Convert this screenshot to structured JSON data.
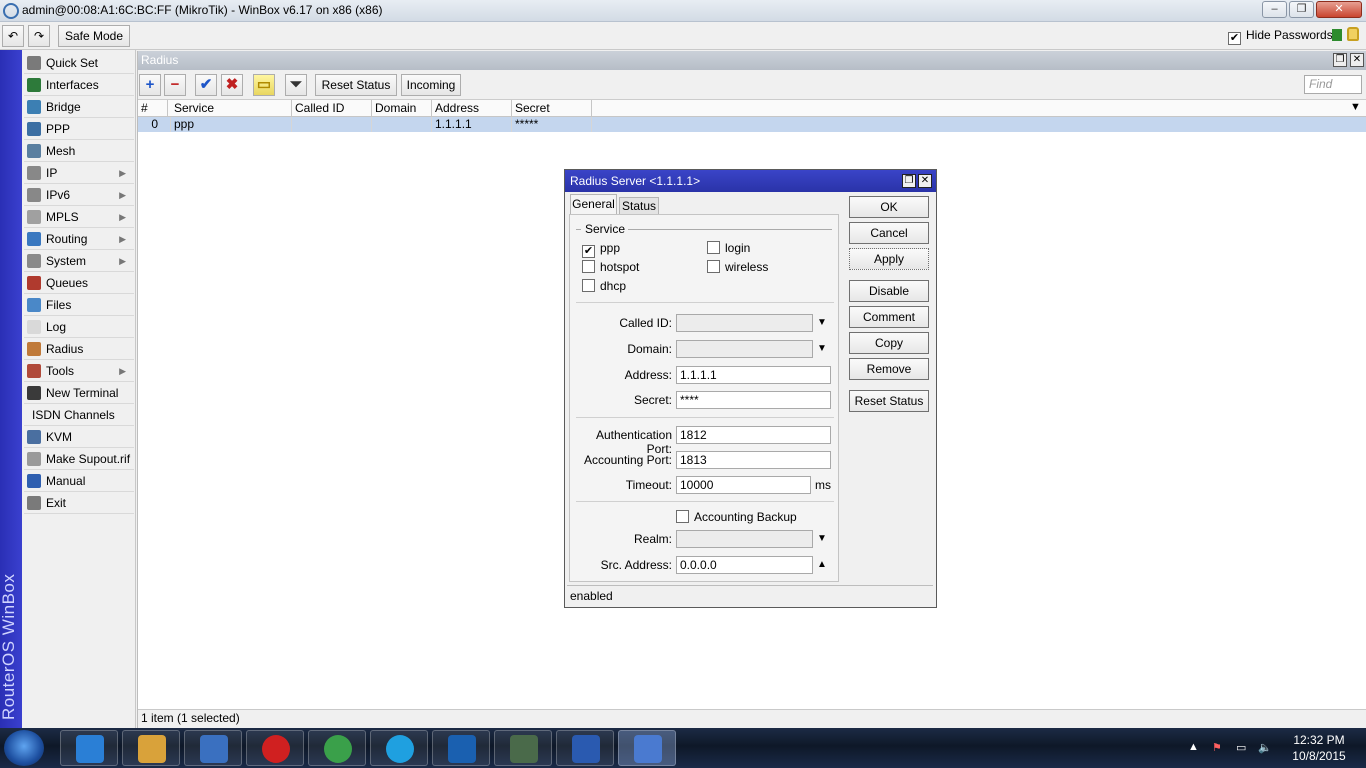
{
  "window": {
    "title": "admin@00:08:A1:6C:BC:FF (MikroTik) - WinBox v6.17 on x86 (x86)",
    "min": "–",
    "max": "❐",
    "close": "✕"
  },
  "toolbar": {
    "undo": "↶",
    "redo": "↷",
    "safe_mode": "Safe Mode",
    "hide_passwords_label": "Hide Passwords",
    "hide_passwords_checked": "✔"
  },
  "brand": {
    "text": "RouterOS WinBox"
  },
  "menu": [
    {
      "label": "Quick Set",
      "icon": "quickset-icon",
      "color": "#7a7a7a"
    },
    {
      "label": "Interfaces",
      "icon": "interfaces-icon",
      "color": "#2d7a3a"
    },
    {
      "label": "Bridge",
      "icon": "bridge-icon",
      "color": "#3c7fb3"
    },
    {
      "label": "PPP",
      "icon": "ppp-icon",
      "color": "#3c6fa3"
    },
    {
      "label": "Mesh",
      "icon": "mesh-icon",
      "color": "#5a7fa0"
    },
    {
      "label": "IP",
      "icon": "ip-icon",
      "color": "#888888",
      "submenu": "▶"
    },
    {
      "label": "IPv6",
      "icon": "ipv6-icon",
      "color": "#888888",
      "submenu": "▶"
    },
    {
      "label": "MPLS",
      "icon": "mpls-icon",
      "color": "#a0a0a0",
      "submenu": "▶"
    },
    {
      "label": "Routing",
      "icon": "routing-icon",
      "color": "#3a78c0",
      "submenu": "▶"
    },
    {
      "label": "System",
      "icon": "system-icon",
      "color": "#8a8a8a",
      "submenu": "▶"
    },
    {
      "label": "Queues",
      "icon": "queues-icon",
      "color": "#b03a2e"
    },
    {
      "label": "Files",
      "icon": "files-icon",
      "color": "#4a88c8"
    },
    {
      "label": "Log",
      "icon": "log-icon",
      "color": "#d9d9d9"
    },
    {
      "label": "Radius",
      "icon": "radius-icon",
      "color": "#c07a3a"
    },
    {
      "label": "Tools",
      "icon": "tools-icon",
      "color": "#b04a3a",
      "submenu": "▶"
    },
    {
      "label": "New Terminal",
      "icon": "terminal-icon",
      "color": "#3a3a3a"
    },
    {
      "label": "ISDN Channels",
      "icon": "",
      "color": ""
    },
    {
      "label": "KVM",
      "icon": "kvm-icon",
      "color": "#4a6fa0"
    },
    {
      "label": "Make Supout.rif",
      "icon": "supout-icon",
      "color": "#9a9a9a"
    },
    {
      "label": "Manual",
      "icon": "manual-icon",
      "color": "#2f5fb0"
    },
    {
      "label": "Exit",
      "icon": "exit-icon",
      "color": "#7a7a7a"
    }
  ],
  "radius_panel": {
    "title": "Radius",
    "restore": "❐",
    "close": "✕",
    "tools": {
      "add": "+",
      "remove": "−",
      "enable": "✔",
      "disable": "✖",
      "comment": "▭",
      "filter": "⏷",
      "reset_status": "Reset Status",
      "incoming": "Incoming",
      "find_placeholder": "Find"
    },
    "columns": [
      "#",
      "Service",
      "Called ID",
      "Domain",
      "Address",
      "Secret"
    ],
    "dropdown": "▼",
    "rows": [
      {
        "num": "0",
        "service": "ppp",
        "called_id": "",
        "domain": "",
        "address": "1.1.1.1",
        "secret": "*****"
      }
    ],
    "status": "1 item (1 selected)"
  },
  "dialog": {
    "title": "Radius Server <1.1.1.1>",
    "restore": "❐",
    "close": "✕",
    "tabs": [
      "General",
      "Status"
    ],
    "service_group": "Service",
    "services": {
      "ppp": {
        "label": "ppp",
        "checked": "✔"
      },
      "login": {
        "label": "login",
        "checked": ""
      },
      "hotspot": {
        "label": "hotspot",
        "checked": ""
      },
      "wireless": {
        "label": "wireless",
        "checked": ""
      },
      "dhcp": {
        "label": "dhcp",
        "checked": ""
      }
    },
    "fields": {
      "called_id": {
        "label": "Called ID:",
        "value": ""
      },
      "domain": {
        "label": "Domain:",
        "value": ""
      },
      "address": {
        "label": "Address:",
        "value": "1.1.1.1"
      },
      "secret": {
        "label": "Secret:",
        "value": "****"
      },
      "auth_port": {
        "label": "Authentication Port:",
        "value": "1812"
      },
      "acct_port": {
        "label": "Accounting Port:",
        "value": "1813"
      },
      "timeout": {
        "label": "Timeout:",
        "value": "10000",
        "unit": "ms"
      },
      "acct_backup": {
        "label": "Accounting Backup",
        "checked": ""
      },
      "realm": {
        "label": "Realm:",
        "value": ""
      },
      "src_address": {
        "label": "Src. Address:",
        "value": "0.0.0.0"
      }
    },
    "dd_down": "▼",
    "dd_up": "▲",
    "buttons": [
      "OK",
      "Cancel",
      "Apply",
      "Disable",
      "Comment",
      "Copy",
      "Remove",
      "Reset Status"
    ],
    "status": "enabled"
  },
  "taskbar": {
    "apps": [
      "ie-icon",
      "explorer-icon",
      "media-player-icon",
      "opera-icon",
      "chrome-icon",
      "skype-icon",
      "outlook-icon",
      "terminal-app-icon",
      "word-icon",
      "winbox-app-icon"
    ],
    "time": "12:32 PM",
    "date": "10/8/2015",
    "tray_up": "▲",
    "tray_flag": "⚑",
    "tray_net": "▭",
    "tray_vol": "🔈"
  }
}
